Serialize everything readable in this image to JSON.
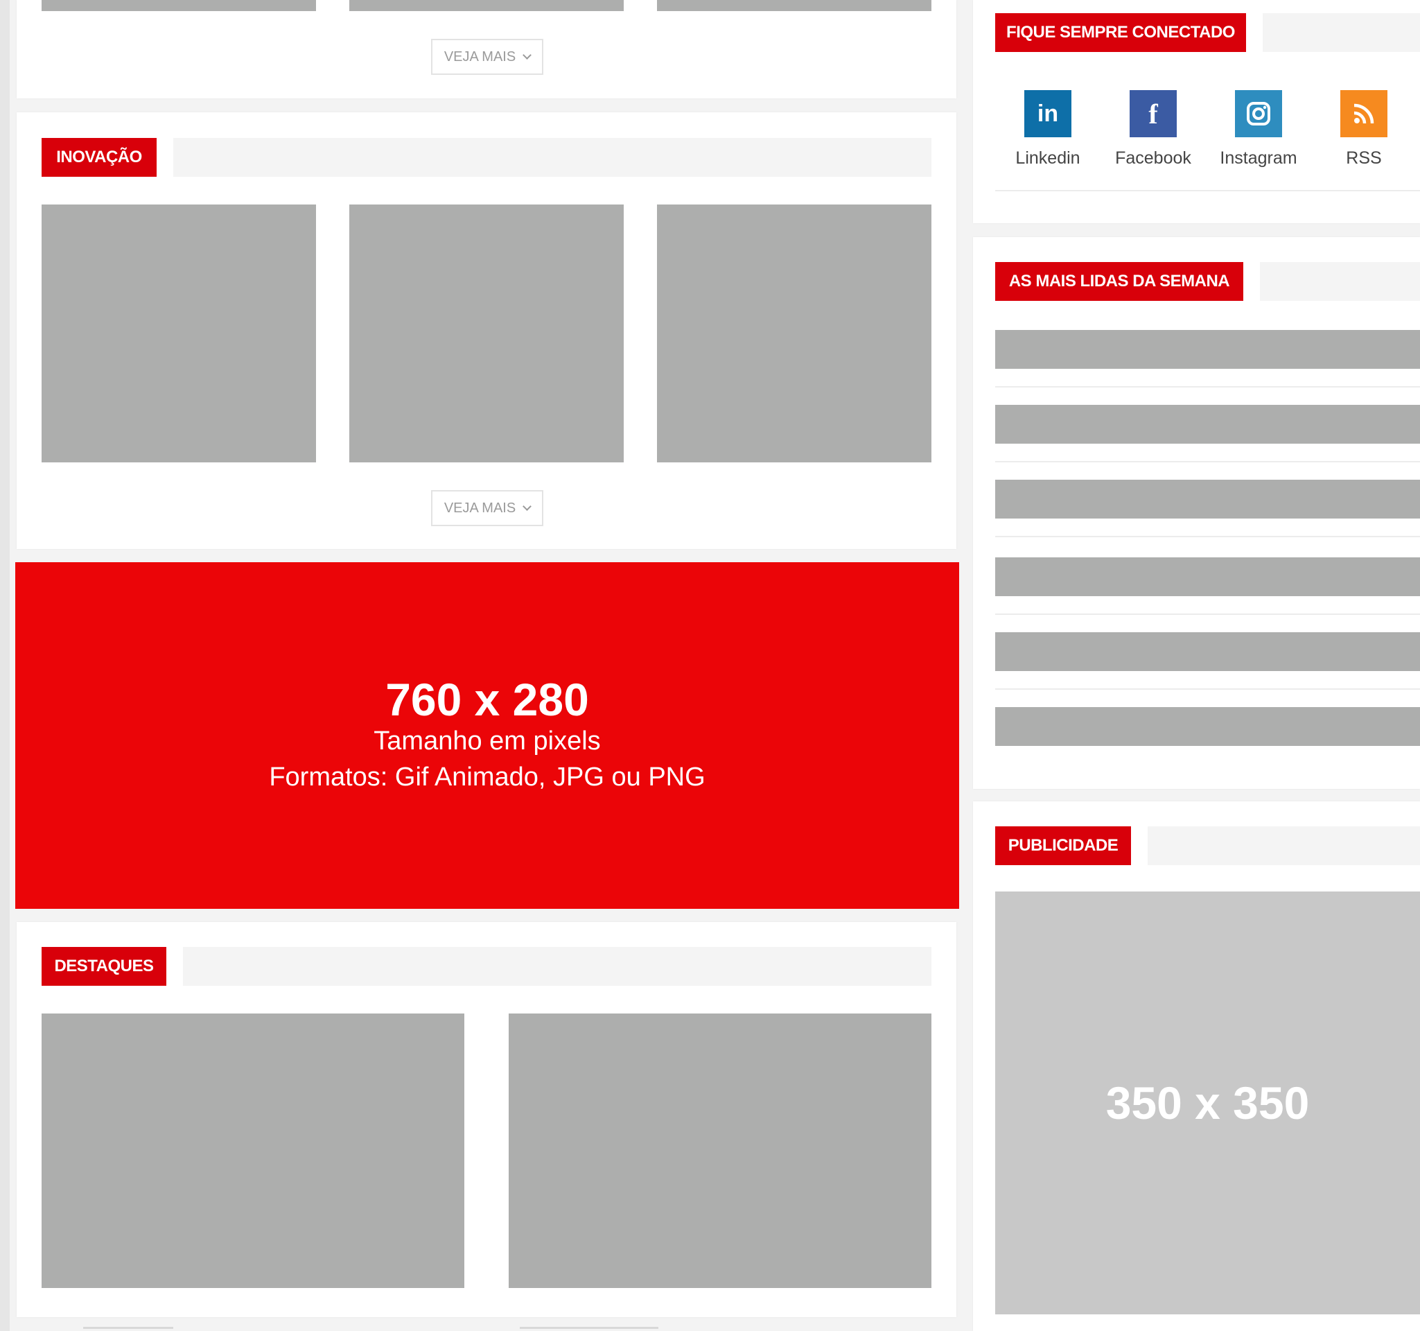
{
  "sections": {
    "top": {
      "more_label": "VEJA MAIS"
    },
    "inovacao": {
      "title": "INOVAÇÃO",
      "more_label": "VEJA MAIS"
    },
    "destaques": {
      "title": "DESTAQUES"
    }
  },
  "banner_ad": {
    "size": "760 x 280",
    "line1": "Tamanho em pixels",
    "line2": "Formatos: Gif Animado, JPG ou PNG"
  },
  "sidebar": {
    "connect": {
      "title": "FIQUE SEMPRE CONECTADO",
      "items": [
        {
          "label": "Linkedin",
          "icon": "linkedin-icon",
          "glyph": "in",
          "color": "#0e6fa8"
        },
        {
          "label": "Facebook",
          "icon": "facebook-icon",
          "glyph": "f",
          "color": "#3b5ba3"
        },
        {
          "label": "Instagram",
          "icon": "instagram-icon",
          "glyph": "◎",
          "color": "#2e8dbf"
        },
        {
          "label": "RSS",
          "icon": "rss-icon",
          "glyph": "))",
          "color": "#f68a1f"
        }
      ]
    },
    "most_read": {
      "title": "AS MAIS LIDAS DA SEMANA"
    },
    "ads": {
      "title": "PUBLICIDADE",
      "size": "350 x 350"
    }
  },
  "colors": {
    "accent": "#d8000a",
    "banner": "#eb0508",
    "placeholder": "#adaead"
  }
}
